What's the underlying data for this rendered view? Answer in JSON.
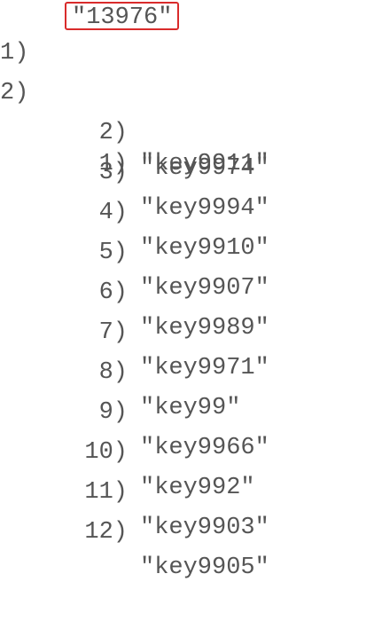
{
  "reply": {
    "cursor": {
      "index": "1)",
      "value": "\"13976\""
    },
    "keys": {
      "index": "2)",
      "items": [
        {
          "index": "1)",
          "value": "\"key9911\""
        },
        {
          "index": "2)",
          "value": "\"key9974\""
        },
        {
          "index": "3)",
          "value": "\"key9994\""
        },
        {
          "index": "4)",
          "value": "\"key9910\""
        },
        {
          "index": "5)",
          "value": "\"key9907\""
        },
        {
          "index": "6)",
          "value": "\"key9989\""
        },
        {
          "index": "7)",
          "value": "\"key9971\""
        },
        {
          "index": "8)",
          "value": "\"key99\""
        },
        {
          "index": "9)",
          "value": "\"key9966\""
        },
        {
          "index": "10)",
          "value": "\"key992\""
        },
        {
          "index": "11)",
          "value": "\"key9903\""
        },
        {
          "index": "12)",
          "value": "\"key9905\""
        }
      ]
    }
  },
  "colors": {
    "text": "#555555",
    "highlight_border": "#d92b2b",
    "background": "#ffffff"
  }
}
